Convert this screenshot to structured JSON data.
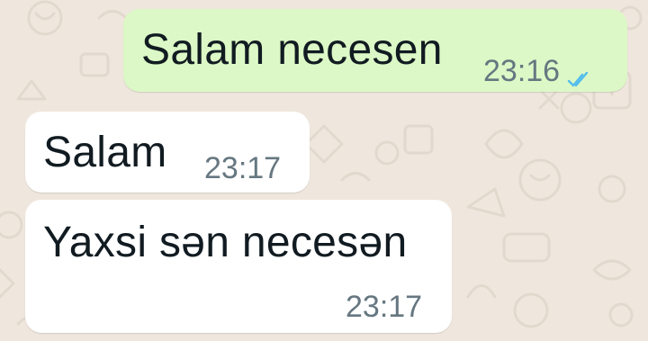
{
  "chat": {
    "messages": [
      {
        "direction": "outgoing",
        "text": "Salam necesen",
        "time": "23:16",
        "status": "read",
        "status_icon": "double-check-icon"
      },
      {
        "direction": "incoming",
        "text": "Salam",
        "time": "23:17"
      },
      {
        "direction": "incoming",
        "text": "Yaxsi sən necesən",
        "time": "23:17"
      }
    ]
  },
  "colors": {
    "background": "#efe7dd",
    "outgoing_bubble": "#dcf8c6",
    "incoming_bubble": "#ffffff",
    "text": "#111b21",
    "meta_text": "#667781",
    "read_ticks": "#53bdeb"
  }
}
